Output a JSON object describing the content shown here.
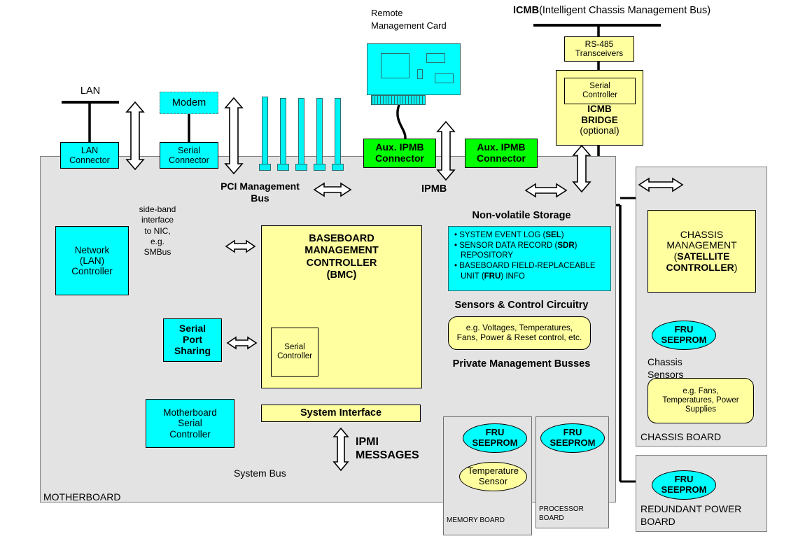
{
  "title_notes": {
    "icmb_bold": "ICMB",
    "icmb_rest": " (Intelligent Chassis Management Bus)",
    "remote_card_line1": "Remote",
    "remote_card_line2": "Management Card"
  },
  "top_right": {
    "rs485": "RS-485\nTransceivers",
    "rs485_l1": "RS-485",
    "rs485_l2": "Transceivers",
    "bridge_serial_l1": "Serial",
    "bridge_serial_l2": "Controller",
    "bridge_l1": "ICMB",
    "bridge_l2": "BRIDGE",
    "bridge_l3": "(optional)"
  },
  "left": {
    "lan": "LAN",
    "modem": "Modem",
    "lan_connector_l1": "LAN",
    "lan_connector_l2": "Connector",
    "serial_connector_l1": "Serial",
    "serial_connector_l2": "Connector",
    "sideband_l1": "side-band",
    "sideband_l2": "interface",
    "sideband_l3": "to NIC,",
    "sideband_l4": "e.g.",
    "sideband_l5": "SMBus",
    "network_l1": "Network",
    "network_l2": "(LAN)",
    "network_l3": "Controller",
    "serial_port_sharing_l1": "Serial",
    "serial_port_sharing_l2": "Port",
    "serial_port_sharing_l3": "Sharing",
    "mb_serial_l1": "Motherboard",
    "mb_serial_l2": "Serial",
    "mb_serial_l3": "Controller"
  },
  "buses": {
    "pci_l1": "PCI Management",
    "pci_l2": "Bus",
    "ipmb": "IPMB",
    "system_bus": "System Bus",
    "ipmi_l1": "IPMI",
    "ipmi_l2": "MESSAGES",
    "private_mgmt": "Private Management Busses"
  },
  "connectors": {
    "aux_ipmb_l1": "Aux. IPMB",
    "aux_ipmb_l2": "Connector"
  },
  "bmc": {
    "l1": "BASEBOARD",
    "l2": "MANAGEMENT",
    "l3": "CONTROLLER",
    "l4": "(BMC)",
    "serial_l1": "Serial",
    "serial_l2": "Controller",
    "system_interface": "System Interface"
  },
  "nvs": {
    "heading": "Non-volatile Storage",
    "item1_pre": "SYSTEM EVENT LOG (",
    "item1_b": "SEL",
    "item1_post": ")",
    "item2_pre": "SENSOR DATA RECORD (",
    "item2_b": "SDR",
    "item2_post": ")",
    "item2_cont": "REPOSITORY",
    "item3_l1": "BASEBOARD FIELD-REPLACEABLE",
    "item3_pre": "UNIT (",
    "item3_b": "FRU",
    "item3_post": ") INFO"
  },
  "sensors": {
    "heading": "Sensors & Control Circuitry",
    "l1": "e.g. Voltages, Temperatures,",
    "l2": "Fans, Power & Reset control, etc."
  },
  "boards": {
    "memory_board": "MEMORY BOARD",
    "processor_board_l1": "PROCESSOR",
    "processor_board_l2": "BOARD",
    "motherboard": "MOTHERBOARD",
    "chassis_board": "CHASSIS BOARD",
    "redundant_power_l1": "REDUNDANT POWER",
    "redundant_power_l2": "BOARD",
    "fru_l1": "FRU",
    "fru_l2": "SEEPROM",
    "temp_sensor_l1": "Temperature",
    "temp_sensor_l2": "Sensor"
  },
  "chassis": {
    "mgmt_l1": "CHASSIS",
    "mgmt_l2": "MANAGEMENT",
    "mgmt_l3_pre": "(",
    "mgmt_l3_b": "SATELLITE",
    "mgmt_l4_b": "CONTROLLER",
    "mgmt_l4_post": ")",
    "sensors_l1": "Chassis",
    "sensors_l2": "Sensors",
    "sensors_box_l1": "e.g. Fans,",
    "sensors_box_l2": "Temperatures, Power",
    "sensors_box_l3": "Supplies"
  },
  "colors": {
    "cyan": "#00FFFF",
    "yellow": "#FFFFA0",
    "green": "#00FF00",
    "panel_gray": "#E3E3E3",
    "line": "#000000"
  }
}
